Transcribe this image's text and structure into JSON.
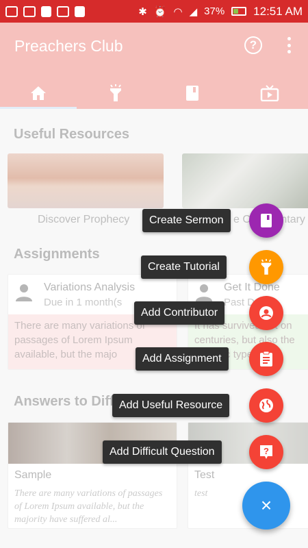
{
  "status_bar": {
    "battery": "37%",
    "time": "12:51 AM"
  },
  "app": {
    "title": "Preachers Club"
  },
  "tabs": [
    {
      "icon": "home-icon"
    },
    {
      "icon": "flashlight-icon"
    },
    {
      "icon": "book-icon"
    },
    {
      "icon": "tv-icon"
    }
  ],
  "sections": {
    "resources_title": "Useful Resources",
    "assignments_title": "Assignments",
    "answers_title": "Answers to Diff"
  },
  "resources": [
    {
      "label": "Discover Prophecy"
    },
    {
      "label": "e Commentary"
    }
  ],
  "assignments": [
    {
      "title": "Variations Analysis",
      "due": "Due in 1 month(s",
      "desc": "There are many variations of passages of Lorem Ipsum available, but the majo"
    },
    {
      "title": "Get It Done",
      "due": "Past D",
      "desc": "It has survived not on centuries, but also the ectronic typeset"
    }
  ],
  "answers": [
    {
      "title": "Sample",
      "desc": "There are many variations of passages of Lorem Ipsum available, but the majority have suffered al..."
    },
    {
      "title": "Test",
      "desc": "test"
    }
  ],
  "speed_dial": {
    "actions": [
      {
        "label": "Create Sermon",
        "icon": "book-icon",
        "color": "#9c27b0"
      },
      {
        "label": "Create Tutorial",
        "icon": "flashlight-icon",
        "color": "#ff9800"
      },
      {
        "label": "Add Contributor",
        "icon": "person-circle-icon",
        "color": "#f44336"
      },
      {
        "label": "Add Assignment",
        "icon": "clipboard-icon",
        "color": "#f44336"
      },
      {
        "label": "Add Useful Resource",
        "icon": "globe-icon",
        "color": "#f44336"
      },
      {
        "label": "Add Difficult Question",
        "icon": "question-icon",
        "color": "#f44336"
      }
    ],
    "main_icon": "×",
    "main_color": "#2f95ec"
  }
}
